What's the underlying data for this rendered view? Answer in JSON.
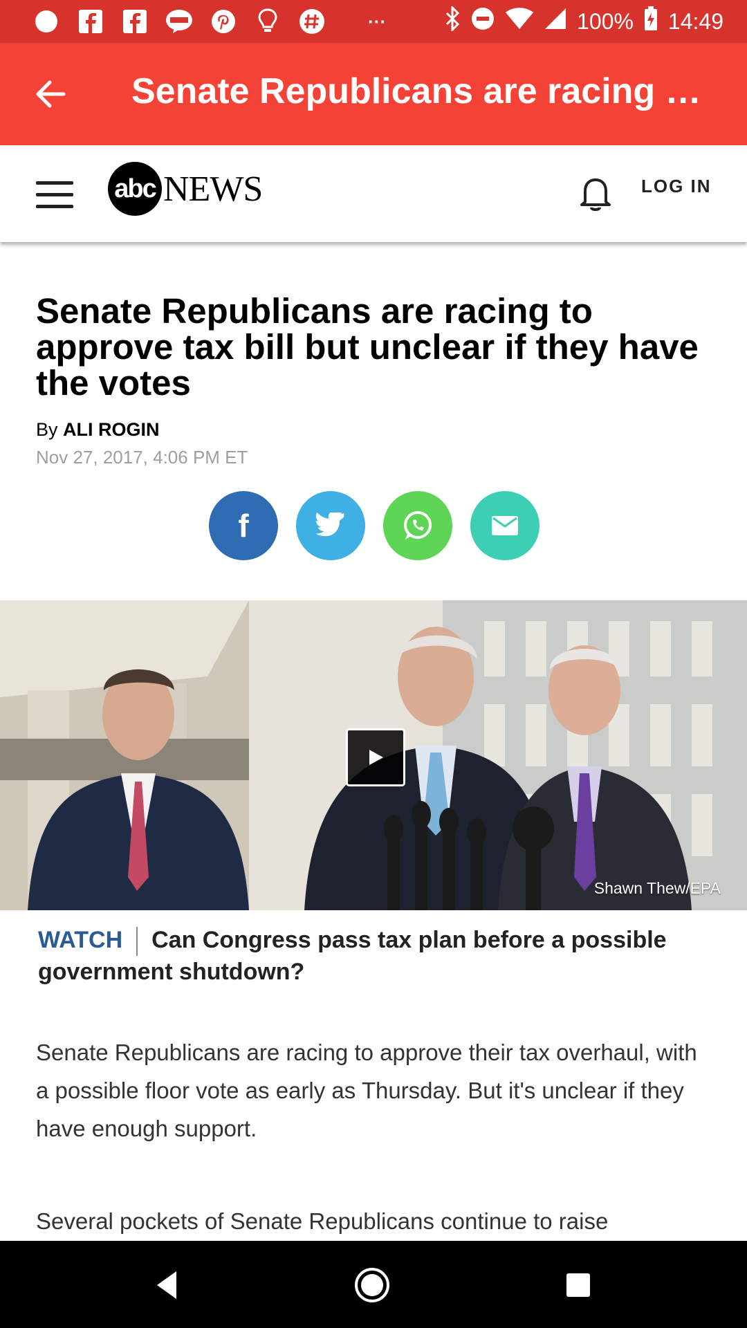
{
  "status_bar": {
    "battery": "100%",
    "time": "14:49",
    "overflow": "···",
    "notification_icons": [
      "chat-bubble-icon",
      "facebook-icon",
      "facebook-icon",
      "line-icon",
      "pinterest-icon",
      "lightbulb-icon",
      "hashtag-icon"
    ]
  },
  "app_bar": {
    "title": "Senate Republicans are racing to..."
  },
  "site_header": {
    "logo_circle": "abc",
    "logo_word": "NEWS",
    "login": "LOG IN"
  },
  "article": {
    "headline": "Senate Republicans are racing to approve tax bill but unclear if they have the votes",
    "by_prefix": "By",
    "author": "ALI ROGIN",
    "date": "Nov 27, 2017, 4:06 PM ET",
    "share_buttons": [
      {
        "name": "facebook",
        "color": "#2f6cb3",
        "glyph": "f"
      },
      {
        "name": "twitter",
        "color": "#3fb0e3"
      },
      {
        "name": "whatsapp",
        "color": "#5ed554"
      },
      {
        "name": "email",
        "color": "#3ccfb4"
      }
    ],
    "photo_credit": "Shawn Thew/EPA",
    "video_label": "WATCH",
    "video_caption": "Can Congress pass tax plan before a possible government shutdown?",
    "paragraphs": [
      "Senate Republicans are racing to approve their tax overhaul, with a possible floor vote as early as Thursday. But it's unclear if they have enough support.",
      "Several pockets of Senate Republicans continue to raise"
    ]
  },
  "colors": {
    "status_bar": "#d7332d",
    "app_bar": "#f44336",
    "watch": "#2b5b93"
  }
}
